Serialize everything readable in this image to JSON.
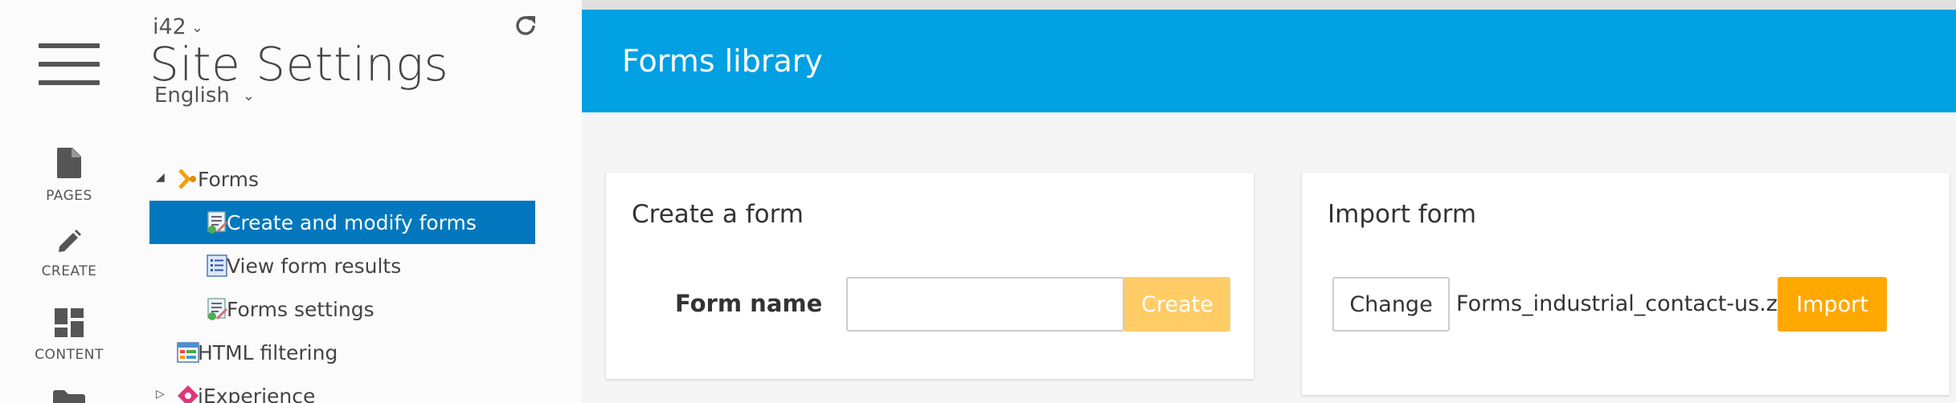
{
  "rail": {
    "items": [
      {
        "label": "PAGES",
        "icon": "page-icon"
      },
      {
        "label": "CREATE",
        "icon": "pencil-icon"
      },
      {
        "label": "CONTENT",
        "icon": "dashboard-icon"
      },
      {
        "label": "",
        "icon": "folder-icon"
      }
    ]
  },
  "sidebar": {
    "site": "i42",
    "title": "Site Settings",
    "language": "English",
    "tree": [
      {
        "label": "Forms",
        "icon": "forms-icon",
        "toggle": "expanded"
      },
      {
        "label": "Create and modify forms",
        "icon": "form-edit-icon",
        "selected": true
      },
      {
        "label": "View form results",
        "icon": "list-icon"
      },
      {
        "label": "Forms settings",
        "icon": "form-settings-icon"
      },
      {
        "label": "HTML filtering",
        "icon": "html-filter-icon"
      },
      {
        "label": "jExperience",
        "icon": "jexperience-icon",
        "toggle": "collapsed"
      }
    ]
  },
  "main": {
    "header_title": "Forms library",
    "create_card": {
      "title": "Create a form",
      "field_label": "Form name",
      "input_value": "",
      "create_label": "Create"
    },
    "import_card": {
      "title": "Import form",
      "change_label": "Change",
      "file_name": "Forms_industrial_contact-us.zip",
      "import_label": "Import"
    }
  },
  "colors": {
    "header": "#00a0e3",
    "selected_row": "#0277bd",
    "create_button": "#ffcc66",
    "import_button": "#ffa800"
  }
}
